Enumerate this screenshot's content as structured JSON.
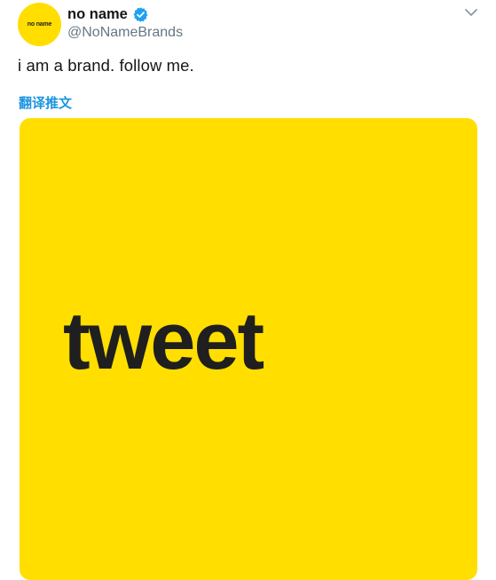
{
  "author": {
    "avatar_text": "no name",
    "display_name": "no name",
    "handle": "@NoNameBrands",
    "verified": true
  },
  "tweet": {
    "text": "i am a brand. follow me.",
    "translate_label": "翻译推文"
  },
  "media": {
    "word": "tweet",
    "background_color": "#ffde00"
  },
  "icons": {
    "verified": "verified-badge-icon",
    "menu": "chevron-down-icon"
  },
  "colors": {
    "link": "#1b95e0",
    "verified": "#1da1f2",
    "secondary_text": "#657786"
  }
}
